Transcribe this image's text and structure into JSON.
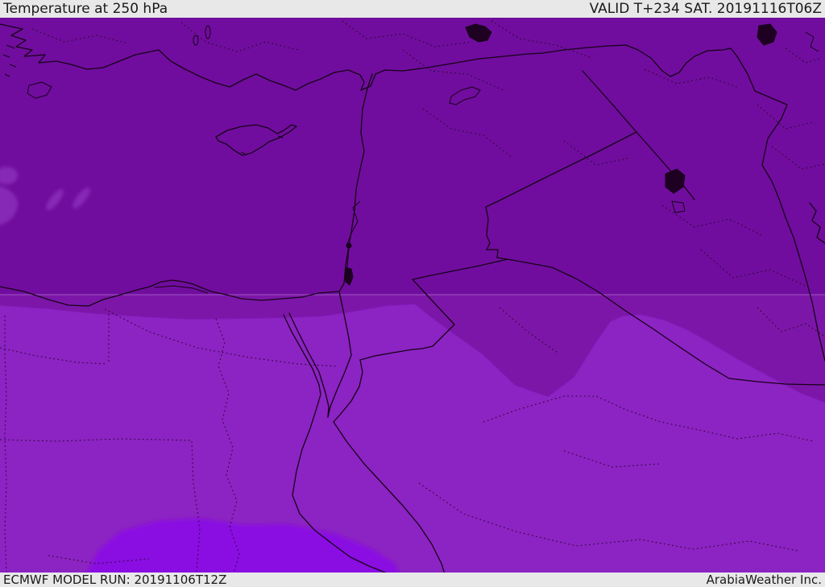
{
  "header": {
    "title": "Temperature at 250 hPa",
    "valid_label": "VALID T+234 SAT. 20191116T06Z"
  },
  "footer": {
    "model_run_label": "ECMWF MODEL RUN: 20191106T12Z",
    "brand_label": "ArabiaWeather Inc."
  },
  "map": {
    "kind": "temperature-field-map",
    "region_shown": "Eastern Mediterranean / Middle East",
    "colors": {
      "temp_cold_north": "#700a9e",
      "temp_band_middle": "#7b12a8",
      "temp_bright_south": "#8c23c3",
      "temp_vivid_patch": "#8a09e2",
      "temp_light_streaks": "#8b2fbb",
      "coast_border_line": "#170117",
      "admin_dashed_line": "#2a0630",
      "lake_fill": "#1e0022",
      "lat_line": "#cb9ce2",
      "bar_background": "#e8e8e8",
      "bar_text": "#1a1a1a"
    }
  }
}
